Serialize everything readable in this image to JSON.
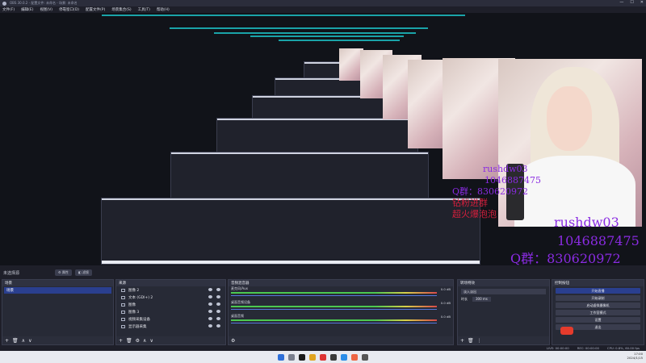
{
  "window": {
    "title": "OBS 30.0.2 - 配置文件: 未命名 - 场景: 未命名",
    "controls": [
      "—",
      "☐",
      "✕"
    ]
  },
  "menu": [
    "文件(F)",
    "编辑(E)",
    "视图(V)",
    "停靠窗口(D)",
    "配置文件(P)",
    "场景集合(S)",
    "工具(T)",
    "帮助(H)"
  ],
  "overlay": {
    "name": "rushdw03",
    "qq": "1046887475",
    "group": "Q群：830620972",
    "line1": "钻粉进群",
    "line2": "超火爆泡泡"
  },
  "dock_title": {
    "label": "未选择源",
    "btn_props": "⚙ 属性",
    "btn_filters": "◧ 滤镜"
  },
  "scenes": {
    "title": "场景",
    "items": [
      "场景"
    ],
    "footer": [
      "+",
      "🗑",
      "∧",
      "∨"
    ]
  },
  "sources": {
    "title": "来源",
    "items": [
      "图像 2",
      "文本 (GDI+) 2",
      "图像",
      "图像 3",
      "视频采集设备",
      "显示器采集"
    ],
    "footer": [
      "+",
      "🗑",
      "⚙",
      "∧",
      "∨"
    ]
  },
  "mixer": {
    "title": "音频混音器",
    "channels": [
      {
        "name": "麦克风/Aux",
        "db": "0.0 dB"
      },
      {
        "name": "桌面音频设备",
        "db": "0.0 dB"
      },
      {
        "name": "桌面音频",
        "db": "0.0 dB"
      }
    ]
  },
  "transitions": {
    "title": "转场特效",
    "type": "淡入淡出",
    "duration_label": "时长",
    "duration": "300 ms"
  },
  "controls": {
    "title": "控制按钮",
    "buttons": [
      "开始直播",
      "开始录制",
      "启动虚拟摄像机",
      "工作室模式",
      "设置",
      "退出"
    ]
  },
  "status": {
    "live": "LIVE: 00:00:00",
    "rec": "REC: 00:00:00",
    "cpu": "CPU: 0.8%, 60.00 fps"
  },
  "clock": {
    "time": "17:00",
    "date": "2024/1/15"
  },
  "colors": {
    "accent": "#2a3f8f",
    "purple": "#8a2be2",
    "red": "#d21f3c",
    "teal": "#1aa3a8"
  }
}
